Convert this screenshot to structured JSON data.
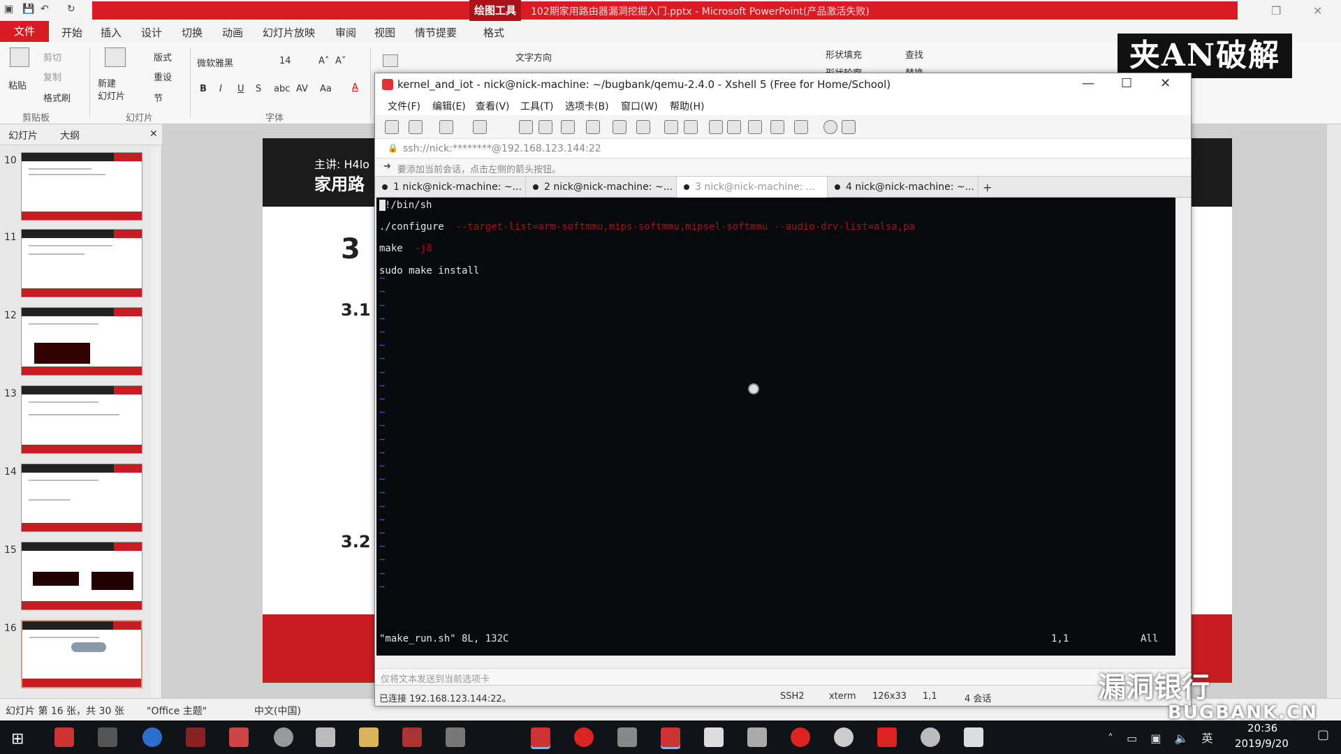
{
  "powerpoint": {
    "context_tool": "绘图工具",
    "doc_title": "102期家用路由器漏洞挖掘入门.pptx - Microsoft PowerPoint(产品激活失败)",
    "tabs": [
      "文件",
      "开始",
      "插入",
      "设计",
      "切换",
      "动画",
      "幻灯片放映",
      "审阅",
      "视图",
      "情节提要",
      "格式"
    ],
    "ribbon": {
      "clipboard": {
        "paste": "粘贴",
        "cut": "剪切",
        "copy": "复制",
        "format_painter": "格式刷",
        "group": "剪贴板"
      },
      "slides": {
        "new_slide": "新建\n幻灯片",
        "layout": "版式",
        "reset": "重设",
        "section": "节",
        "group": "幻灯片"
      },
      "font": {
        "name": "微软雅黑",
        "size": "14",
        "group": "字体"
      },
      "paragraph": {
        "text_direction": "文字方向"
      },
      "editing": {
        "shape_fill": "形状填充",
        "find": "查找",
        "shape_outline": "形状轮廓",
        "replace": "替换"
      }
    },
    "brand_logo": "夹AN破解",
    "panel_tabs": {
      "slides": "幻灯片",
      "outline": "大纲"
    },
    "thumbnails": [
      "10",
      "11",
      "12",
      "13",
      "14",
      "15",
      "16"
    ],
    "slide": {
      "speaker": "主讲: H4lo",
      "title": "家用路",
      "section_number": "3",
      "sub1": "3.1",
      "sub2": "3.2"
    },
    "status": {
      "slide_info": "幻灯片 第 16 张，共 30 张",
      "theme": "\"Office 主题\"",
      "language": "中文(中国)"
    }
  },
  "xshell": {
    "title": "kernel_and_iot - nick@nick-machine: ~/bugbank/qemu-2.4.0 - Xshell 5 (Free for Home/School)",
    "menu": [
      "文件(F)",
      "编辑(E)",
      "查看(V)",
      "工具(T)",
      "选项卡(B)",
      "窗口(W)",
      "帮助(H)"
    ],
    "address": "ssh://nick:********@192.168.123.144:22",
    "hint": "要添加当前会话，点击左侧的箭头按钮。",
    "tabs": [
      "1 nick@nick-machine: ~...",
      "2 nick@nick-machine: ~...",
      "3 nick@nick-machine: ...",
      "4 nick@nick-machine: ~..."
    ],
    "active_tab": 2,
    "terminal": {
      "lines": [
        {
          "text": "!/bin/sh",
          "kind": "normal"
        },
        {
          "text": "",
          "kind": "normal"
        },
        {
          "text": "./configure",
          "kind": "normal",
          "extra": "--target-list=arm-softmmu,mips-softmmu,mipsel-softmmu --audio-drv-list=alsa,pa"
        },
        {
          "text": "",
          "kind": "normal"
        },
        {
          "text": "make",
          "kind": "normal",
          "extra": "-j8"
        },
        {
          "text": "",
          "kind": "normal"
        },
        {
          "text": "sudo make install",
          "kind": "normal"
        }
      ],
      "tilde_count": 24,
      "status_file": "\"make_run.sh\" 8L, 132C",
      "status_pos": "1,1",
      "status_all": "All"
    },
    "input_hint": "仅将文本发送到当前选项卡",
    "status": {
      "connection": "已连接 192.168.123.144:22。",
      "protocol": "SSH2",
      "term": "xterm",
      "size": "126x33",
      "cursor": "1,1",
      "sessions": "4 会话"
    }
  },
  "watermark": {
    "cn": "漏洞银行",
    "en": "BUGBANK.CN"
  },
  "taskbar": {
    "time": "20:36",
    "date": "2019/9/20",
    "ime": "英"
  },
  "colors": {
    "powerpoint_red": "#d91c24",
    "terminal_bg": "#07090d",
    "terminal_tilde": "#3b63d6",
    "terminal_red": "#a3131a"
  }
}
